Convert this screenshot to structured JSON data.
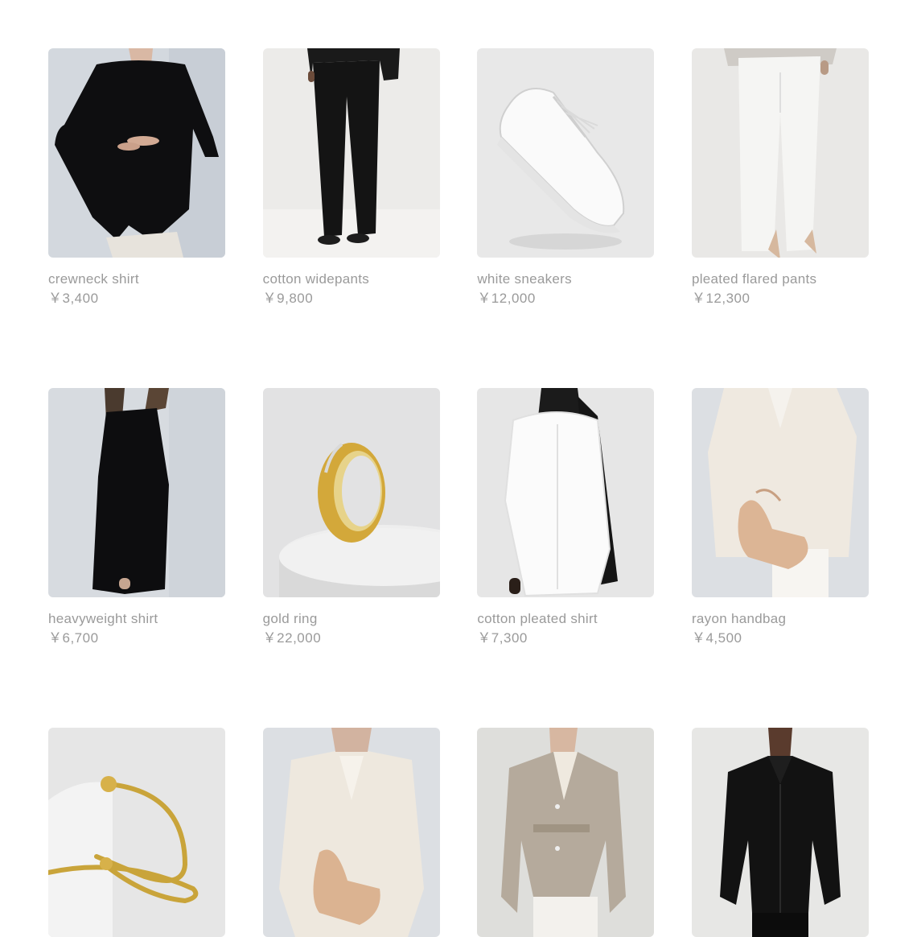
{
  "products": [
    {
      "name": "crewneck shirt",
      "price": "￥3,400",
      "image": "model-black-crewneck-shirt"
    },
    {
      "name": "cotton widepants",
      "price": "￥9,800",
      "image": "model-black-wide-pants"
    },
    {
      "name": "white sneakers",
      "price": "￥12,000",
      "image": "white-sneaker"
    },
    {
      "name": "pleated flared pants",
      "price": "￥12,300",
      "image": "model-white-flared-pants"
    },
    {
      "name": "heavyweight shirt",
      "price": "￥6,700",
      "image": "model-black-long-shirt"
    },
    {
      "name": "gold ring",
      "price": "￥22,000",
      "image": "gold-ring"
    },
    {
      "name": "cotton pleated shirt",
      "price": "￥7,300",
      "image": "model-white-shirt-black-scarf"
    },
    {
      "name": "rayon handbag",
      "price": "￥4,500",
      "image": "model-beige-blazer-handbag"
    },
    {
      "name": "",
      "price": "",
      "image": "gold-bracelet"
    },
    {
      "name": "",
      "price": "",
      "image": "model-beige-blazer-handbag"
    },
    {
      "name": "",
      "price": "",
      "image": "model-linen-jacket"
    },
    {
      "name": "",
      "price": "",
      "image": "model-black-shirt"
    }
  ]
}
